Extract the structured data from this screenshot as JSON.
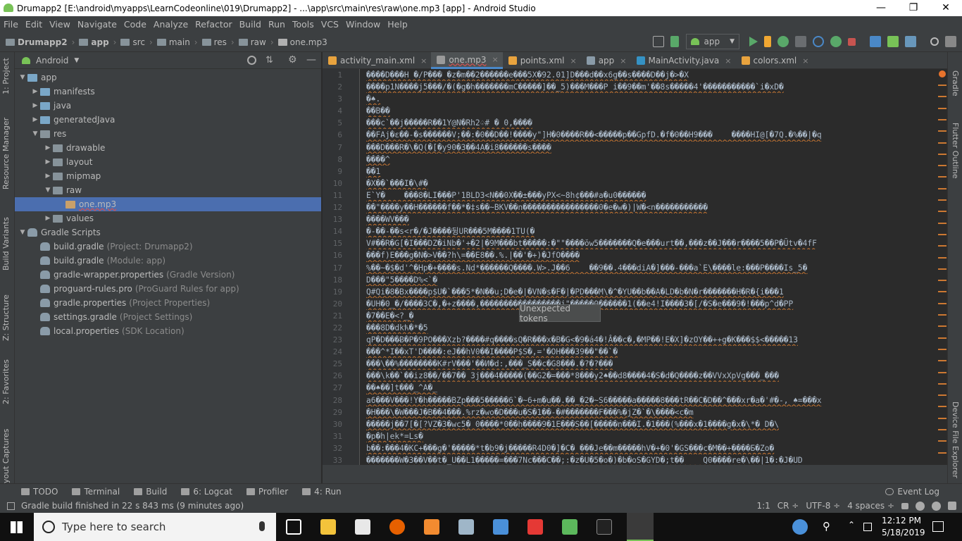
{
  "window": {
    "title": "Drumapp2 [E:\\android\\myapps\\LearnCodeonline\\019\\Drumapp2] - ...\\app\\src\\main\\res\\raw\\one.mp3 [app] - Android Studio",
    "min": "—",
    "max": "❐",
    "close": "✕"
  },
  "menu": [
    "File",
    "Edit",
    "View",
    "Navigate",
    "Code",
    "Analyze",
    "Refactor",
    "Build",
    "Run",
    "Tools",
    "VCS",
    "Window",
    "Help"
  ],
  "breadcrumbs": [
    "Drumapp2",
    "app",
    "src",
    "main",
    "res",
    "raw",
    "one.mp3"
  ],
  "run_config": "app",
  "project_panel": {
    "view": "Android",
    "tree": [
      {
        "label": "app",
        "extra": "",
        "depth": 0,
        "arrow": "▼",
        "kind": "folder-blue"
      },
      {
        "label": "manifests",
        "extra": "",
        "depth": 1,
        "arrow": "▶",
        "kind": "folder-blue"
      },
      {
        "label": "java",
        "extra": "",
        "depth": 1,
        "arrow": "▶",
        "kind": "folder-blue"
      },
      {
        "label": "generatedJava",
        "extra": "",
        "depth": 1,
        "arrow": "▶",
        "kind": "folder-blue"
      },
      {
        "label": "res",
        "extra": "",
        "depth": 1,
        "arrow": "▼",
        "kind": "folder"
      },
      {
        "label": "drawable",
        "extra": "",
        "depth": 2,
        "arrow": "▶",
        "kind": "folder"
      },
      {
        "label": "layout",
        "extra": "",
        "depth": 2,
        "arrow": "▶",
        "kind": "folder"
      },
      {
        "label": "mipmap",
        "extra": "",
        "depth": 2,
        "arrow": "▶",
        "kind": "folder"
      },
      {
        "label": "raw",
        "extra": "",
        "depth": 2,
        "arrow": "▼",
        "kind": "folder"
      },
      {
        "label": "one.mp3",
        "extra": "",
        "depth": 3,
        "arrow": "",
        "kind": "file",
        "selected": true
      },
      {
        "label": "values",
        "extra": "",
        "depth": 2,
        "arrow": "▶",
        "kind": "folder"
      },
      {
        "label": "Gradle Scripts",
        "extra": "",
        "depth": 0,
        "arrow": "▼",
        "kind": "gradle"
      },
      {
        "label": "build.gradle",
        "extra": "(Project: Drumapp2)",
        "depth": 1,
        "arrow": "",
        "kind": "gradle"
      },
      {
        "label": "build.gradle",
        "extra": "(Module: app)",
        "depth": 1,
        "arrow": "",
        "kind": "gradle"
      },
      {
        "label": "gradle-wrapper.properties",
        "extra": "(Gradle Version)",
        "depth": 1,
        "arrow": "",
        "kind": "props"
      },
      {
        "label": "proguard-rules.pro",
        "extra": "(ProGuard Rules for app)",
        "depth": 1,
        "arrow": "",
        "kind": "props"
      },
      {
        "label": "gradle.properties",
        "extra": "(Project Properties)",
        "depth": 1,
        "arrow": "",
        "kind": "props"
      },
      {
        "label": "settings.gradle",
        "extra": "(Project Settings)",
        "depth": 1,
        "arrow": "",
        "kind": "gradle"
      },
      {
        "label": "local.properties",
        "extra": "(SDK Location)",
        "depth": 1,
        "arrow": "",
        "kind": "props"
      }
    ]
  },
  "tabs": [
    {
      "label": "activity_main.xml",
      "active": false,
      "color": "#e8a33e"
    },
    {
      "label": "one.mp3",
      "active": true,
      "color": "#9a9a9a"
    },
    {
      "label": "points.xml",
      "active": false,
      "color": "#e8a33e"
    },
    {
      "label": "app",
      "active": false,
      "color": "#8a9ba8"
    },
    {
      "label": "MainActivity.java",
      "active": false,
      "color": "#3592c4"
    },
    {
      "label": "colors.xml",
      "active": false,
      "color": "#e8a33e"
    }
  ],
  "editor": {
    "lines": [
      "����D���H �/P��� �z�m��2������e���5X�92.01]D���d��x6g��s����D��j�>�X",
      "����p1N����j5���/�(�g�h�������mC�����]��_5)���M���P i��9��m'��8s�����4'�����������`i�xD�",
      "�♠.",
      "��B��",
      "���c`��j�����R��1Y@N�Rh2♤# � 0,����",
      "��FAj�ε��-�s������V;��:�0��D��!����y\"]H�0����R��<�����p��GpfD.�f�0��H9���    ����HI@[�7Q.�%��|�q",
      "���D���R�\\�Q(�[�y90�3��4A�i8������s����",
      "����^",
      "��1",
      "�X��`���I�\\#�",
      "E`Y�    ���8�LI���P'1BLD3<N��0X��±���yPX<~8h¢���#a�u0������",
      "��\"����y��H������f��*�‡s��~BKV��n����������������0�e�w�)|W�<n�����������",
      "����WV���",
      "�-��-��s<r�/�J����뒹UR���5M����1TU(�",
      "V#��R�G[�I���DZ�iNb�'+�2|�9M���bt�����:�\"\"����ŏw5�������Q�e���urt��,���z��J���r����5��P�Ũtv�4fF",
      "���f)E���g�N�>V��?h\\=��E8��.%.|��'�+)�JfO����",
      "%��~�$�d'^�Hp�+����s.Nd*������Q����.W>.J��6    ��9��.4���diA�]���-���a`E\\����le:���P����Is_5�",
      "D���\"5����D%<`�",
      "Q#Qi�8�Bx����p$U�`���5*�N��u;D�e�|�VN�s�F�|�PD���M\\�^�YU��b��A�LD�b�N�r�������H�R�{i���1",
      "�UH�0_�/����3C�,�+z����,�����������������j\"�����0������1(��e4!I����3�[/�S�e���9�!���p^d�PP",
      "�7��E�<?_�",
      "���8D�dkћ�*�5",
      "qP�D���Ƀ�P�9PO���Xzb?����#q����sQ�R���x�B�G<�9�á4�!Â��c�,�MP��!E�X]�zOY��++g�K���$$<�����13",
      "���^*I��xT'D����:eJ��hV0��I����P$S�,='�OH���39��\"��`�",
      "���\\��%��������K#rV���'��И�d:,���_S��c�G8���.�?�?���",
      "���\\k��`��iz8��/��7�� 3j���4�����(��G2�=���*8���y2♠��d8����4�S�d�Q����z��VVxXpVg���_���",
      "��♠��]t���_^A�_",
      "a6���V���!Y�h�����BZp���5�����6`�~6+m�u��.��_�2�~S6�����a�����8���tR��C�D��^���xr�a�'#�-, ♠=���x",
      "�H���\\�W���J�B��4���.%rz�wo�D���u�S�1��-�#�������F���%�jZ�`�\\����<c�m",
      "�����j��7[�[?VZ�3�wc5� 0����*0��h����9�1E���S��[�����n���I.�1���(%���x�1����g�x�\\*� D�\\",
      "�p�h|ek*=Ls�",
      "b��:���4�KC+���g�'�����*t�b9�j�����R4D0�]�C� ���Je��m�����hV�+�0'�GS���c�M��+����Б�Zo�",
      "�������W�3��V��t�_U��L1�����=���7Nc���C��;:�z�U�5�o�)�b�oS�GYD�;t��    Q0����re�\\��|1�:�J�UD"
    ],
    "tooltip": "Unexpected tokens"
  },
  "left_tools": [
    "1: Project",
    "Resource Manager",
    "Build Variants",
    "Z: Structure",
    "2: Favorites",
    "Layout Captures"
  ],
  "right_tools": [
    "Gradle",
    "Flutter Outline",
    "Device File Explorer"
  ],
  "bottom_tools": [
    "TODO",
    "Terminal",
    "Build",
    "6: Logcat",
    "Profiler",
    "4: Run"
  ],
  "event_log": "Event Log",
  "status": {
    "message": "Gradle build finished in 22 s 843 ms (9 minutes ago)",
    "position": "1:1",
    "line_sep": "CR ÷",
    "encoding": "UTF-8 ÷",
    "indent": "4 spaces ÷"
  },
  "taskbar": {
    "search_placeholder": "Type here to search",
    "time": "12:12 PM",
    "date": "5/18/2019"
  }
}
